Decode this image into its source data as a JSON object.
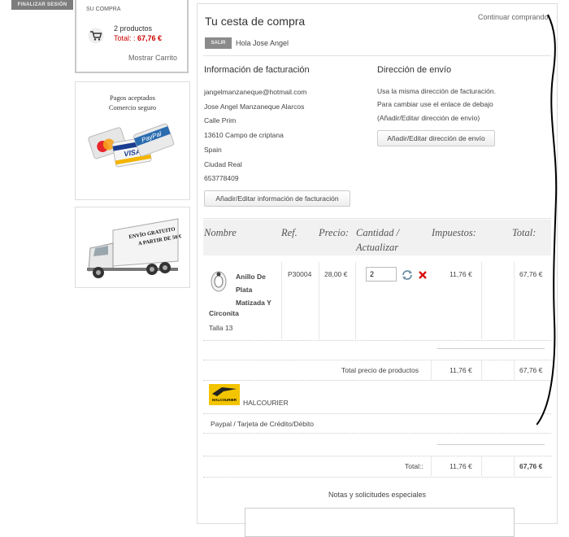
{
  "sidebar": {
    "logout_label": "FINALIZAR SESIÓN",
    "cart": {
      "title": "SU COMPRA",
      "count": "2 productos",
      "total_prefix": "Total: :",
      "total_value": "67,76 €",
      "show_link": "Mostrar Carrito"
    },
    "payments": {
      "line1": "Pagos aceptados",
      "line2": "Comercio seguro"
    },
    "shipping_promo": {
      "line1": "Envío gratuito",
      "line2": "a partir de 50 €"
    }
  },
  "main": {
    "title": "Tu cesta de compra",
    "continue_link": "Continuar comprando",
    "salir_label": "SALIR",
    "greeting": "Hola Jose Angel"
  },
  "billing": {
    "title": "Información de facturación",
    "email": "jangelmanzaneque@hotmail.com",
    "name": "Jose Angel Manzaneque Alarcos",
    "street": "Calle Prim",
    "city": "13610 Campo de criptana",
    "country": "Spain",
    "province": "Ciudad Real",
    "phone": "653778409",
    "edit_button": "Añadir/Editar información de facturación"
  },
  "shipping": {
    "title": "Dirección de envío",
    "line1": "Usa la misma dirección de facturación.",
    "line2": "Para cambiar use el enlace de debajo",
    "line3": "(Añadir/Editar dirección de envío)",
    "edit_button": "Añadir/Editar dirección de envío"
  },
  "table": {
    "headers": {
      "name": "Nombre",
      "ref": "Ref.",
      "price": "Precio:",
      "qty_line1": "Cantidad /",
      "qty_line2": "Actualizar",
      "tax": "Impuestos:",
      "total": "Total:"
    },
    "item": {
      "name_line1": "Anillo De",
      "name_line2": "Plata",
      "name_line3": "Matizada Y",
      "name_line4": "Circonita",
      "variant": "Talla 13",
      "ref": "P30004",
      "price": "28,00 €",
      "qty": "2",
      "tax": "11,76 €",
      "total": "67,76 €"
    },
    "products_total_label": "Total precio de productos",
    "products_tax": "11,76 €",
    "products_total": "67,76 €",
    "carrier_logo_text": "HALCOURIER",
    "carrier_name": "HALCOURIER",
    "payment_method": "Paypal / Tarjeta de Crédito/Débito",
    "grand_total_label": "Total::",
    "grand_tax": "11,76 €",
    "grand_total": "67,76 €"
  },
  "notes_title": "Notas y solicitudes especiales",
  "colors": {
    "price_red": "#cc0000",
    "remove_red": "#d81010",
    "carrier_yellow": "#f3c400"
  }
}
